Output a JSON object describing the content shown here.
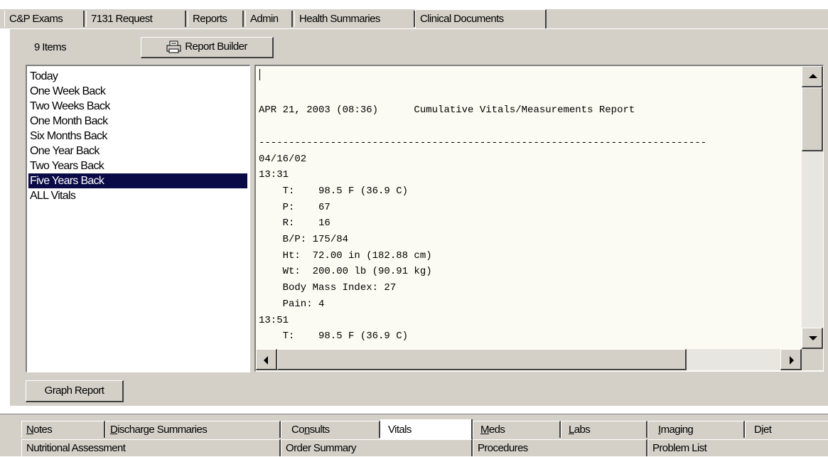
{
  "top_tabs": [
    {
      "label": "C&P Exams"
    },
    {
      "label": "7131 Request"
    },
    {
      "label": "Reports"
    },
    {
      "label": "Admin"
    },
    {
      "label": "Health Summaries"
    },
    {
      "label": "Clinical Documents"
    }
  ],
  "items_count": "9 Items",
  "report_builder_label": "Report Builder",
  "graph_report_label": "Graph Report",
  "date_ranges": [
    "Today",
    "One Week Back",
    "Two Weeks Back",
    "One Month Back",
    "Six Months Back",
    "One Year Back",
    "Two Years Back",
    "Five Years Back",
    "ALL Vitals"
  ],
  "selected_range": "Five Years Back",
  "report_lines": [
    "",
    "",
    "APR 21, 2003 (08:36)      Cumulative Vitals/Measurements Report",
    "",
    "---------------------------------------------------------------------------",
    "04/16/02",
    "13:31",
    "    T:    98.5 F (36.9 C)",
    "    P:    67",
    "    R:    16",
    "    B/P: 175/84",
    "    Ht:  72.00 in (182.88 cm)",
    "    Wt:  200.00 lb (90.91 kg)",
    "    Body Mass Index: 27",
    "    Pain: 4",
    "13:51",
    "    T:    98.5 F (36.9 C)"
  ],
  "bottom_tabs_row1": [
    {
      "pre": "",
      "u": "N",
      "post": "otes"
    },
    {
      "pre": "",
      "u": "D",
      "post": "ischarge Summaries"
    },
    {
      "pre": "Co",
      "u": "n",
      "post": "sults"
    },
    {
      "pre": "Vitals",
      "u": "",
      "post": ""
    },
    {
      "pre": "",
      "u": "M",
      "post": "eds"
    },
    {
      "pre": "",
      "u": "L",
      "post": "abs"
    },
    {
      "pre": "",
      "u": "I",
      "post": "maging"
    },
    {
      "pre": "D",
      "u": "i",
      "post": "et"
    }
  ],
  "bottom_tabs_row2": [
    {
      "label": "Nutritional Assessment"
    },
    {
      "label": "Order Summary"
    },
    {
      "label": "Procedures"
    },
    {
      "label": "Problem List"
    }
  ],
  "colors": {
    "selection": "#0a0a46",
    "report_bg": "#fcfbf3",
    "chrome": "#d4d0c8"
  }
}
